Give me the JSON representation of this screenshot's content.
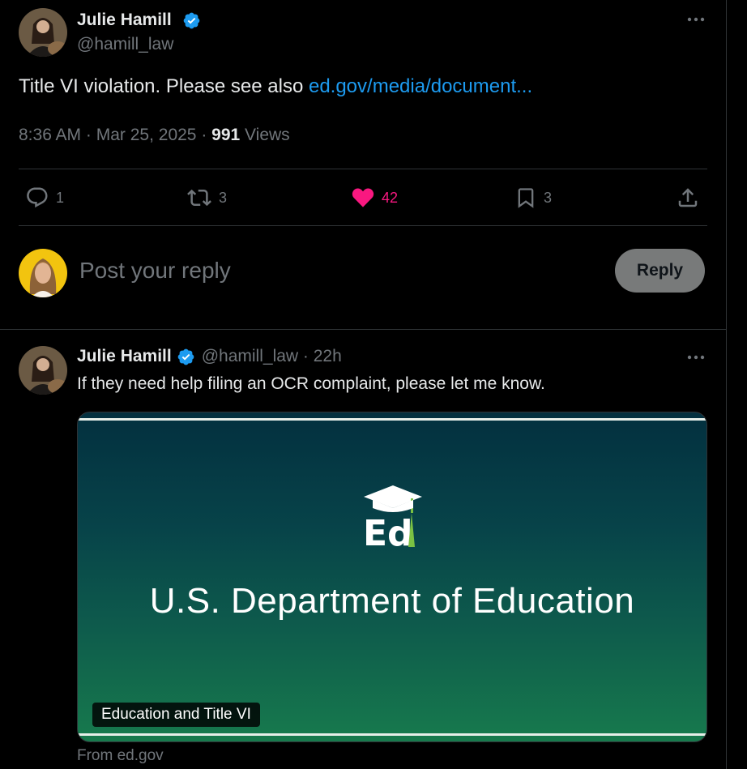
{
  "main_tweet": {
    "author_name": "Julie Hamill",
    "handle": "@hamill_law",
    "text": "Title VI violation. Please see also ",
    "link_text": "ed.gov/media/document...",
    "time": "8:36 AM",
    "separator": " · ",
    "date": "Mar 25, 2025",
    "views_count": "991",
    "views_label": " Views"
  },
  "actions": {
    "replies": "1",
    "reposts": "3",
    "likes": "42",
    "bookmarks": "3"
  },
  "reply_box": {
    "placeholder": "Post your reply",
    "button_label": "Reply"
  },
  "reply_tweet": {
    "author_name": "Julie Hamill",
    "handle": "@hamill_law",
    "separator": " · ",
    "age": "22h",
    "text": "If they need help filing an OCR complaint, please let me know."
  },
  "link_card": {
    "image_title": "U.S. Department of Education",
    "label": "Education and Title VI",
    "source": "From ed.gov"
  },
  "colors": {
    "background": "#000000",
    "link": "#1d9bf0",
    "like": "#f91880",
    "muted": "#71767b",
    "verified": "#1d9bf0"
  },
  "icons": [
    "verified-badge-icon",
    "more-icon",
    "reply-icon",
    "repost-icon",
    "heart-icon",
    "bookmark-icon",
    "share-icon",
    "ed-logo-icon"
  ]
}
